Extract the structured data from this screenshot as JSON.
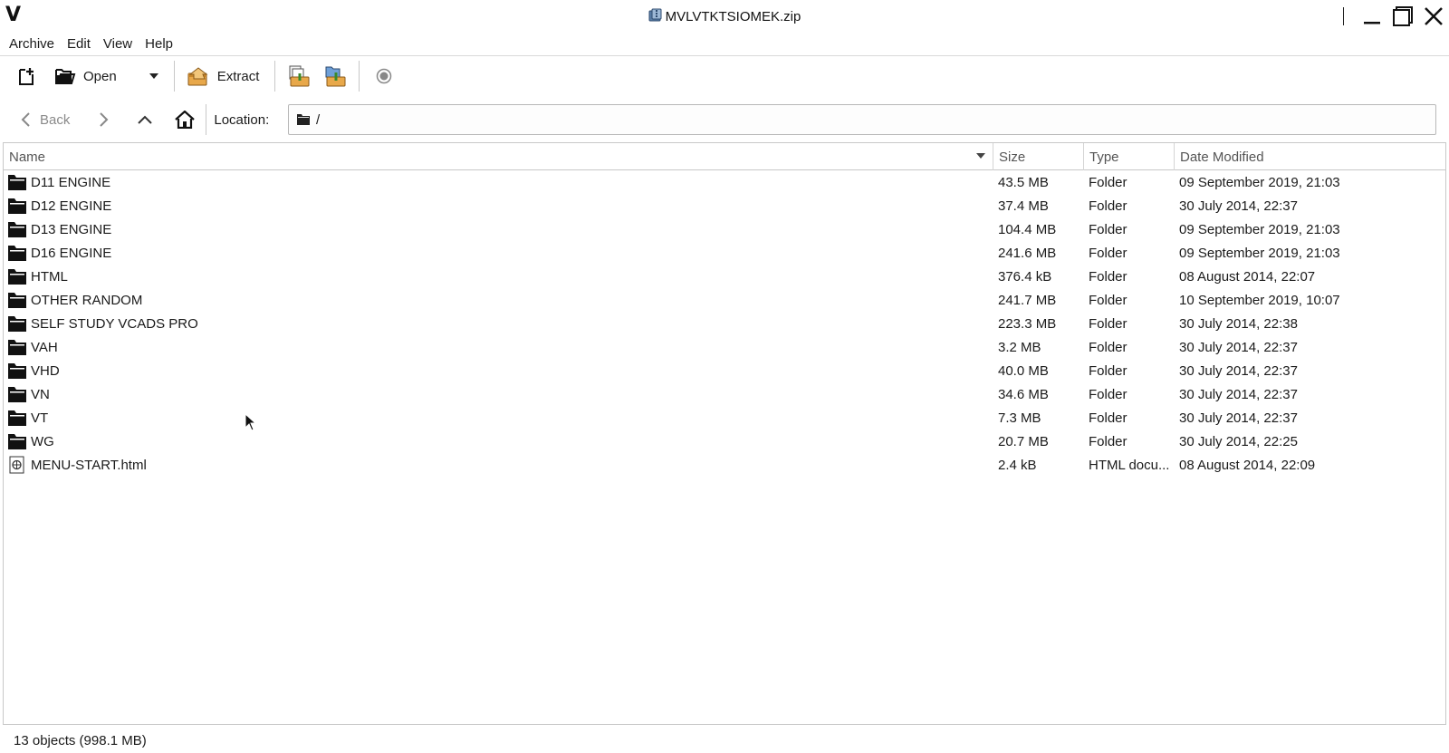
{
  "window": {
    "title": "MVLVTKTSIOMEK.zip",
    "logo": "V",
    "controls": [
      "minimize-icon",
      "maximize-icon",
      "close-icon"
    ]
  },
  "menubar": {
    "items": [
      "Archive",
      "Edit",
      "View",
      "Help"
    ]
  },
  "toolbar": {
    "new_icon": "new-archive-icon",
    "open_label": "Open",
    "extract_label": "Extract",
    "add_files_icon": "add-files-icon",
    "add_folder_icon": "add-folder-icon",
    "stop_icon": "stop-icon"
  },
  "locationbar": {
    "back_label": "Back",
    "location_label": "Location:",
    "path": "/"
  },
  "filelist": {
    "columns": {
      "name": "Name",
      "size": "Size",
      "type": "Type",
      "date": "Date Modified"
    },
    "rows": [
      {
        "name": "D11 ENGINE",
        "size": "43.5 MB",
        "type": "Folder",
        "date": "09 September 2019, 21:03",
        "icon": "folder-icon"
      },
      {
        "name": "D12 ENGINE",
        "size": "37.4 MB",
        "type": "Folder",
        "date": "30 July 2014, 22:37",
        "icon": "folder-icon"
      },
      {
        "name": "D13 ENGINE",
        "size": "104.4 MB",
        "type": "Folder",
        "date": "09 September 2019, 21:03",
        "icon": "folder-icon"
      },
      {
        "name": "D16 ENGINE",
        "size": "241.6 MB",
        "type": "Folder",
        "date": "09 September 2019, 21:03",
        "icon": "folder-icon"
      },
      {
        "name": "HTML",
        "size": "376.4 kB",
        "type": "Folder",
        "date": "08 August 2014, 22:07",
        "icon": "folder-icon"
      },
      {
        "name": "OTHER RANDOM",
        "size": "241.7 MB",
        "type": "Folder",
        "date": "10 September 2019, 10:07",
        "icon": "folder-icon"
      },
      {
        "name": "SELF STUDY VCADS PRO",
        "size": "223.3 MB",
        "type": "Folder",
        "date": "30 July 2014, 22:38",
        "icon": "folder-icon"
      },
      {
        "name": "VAH",
        "size": "3.2 MB",
        "type": "Folder",
        "date": "30 July 2014, 22:37",
        "icon": "folder-icon"
      },
      {
        "name": "VHD",
        "size": "40.0 MB",
        "type": "Folder",
        "date": "30 July 2014, 22:37",
        "icon": "folder-icon"
      },
      {
        "name": "VN",
        "size": "34.6 MB",
        "type": "Folder",
        "date": "30 July 2014, 22:37",
        "icon": "folder-icon"
      },
      {
        "name": "VT",
        "size": "7.3 MB",
        "type": "Folder",
        "date": "30 July 2014, 22:37",
        "icon": "folder-icon"
      },
      {
        "name": "WG",
        "size": "20.7 MB",
        "type": "Folder",
        "date": "30 July 2014, 22:25",
        "icon": "folder-icon"
      },
      {
        "name": "MENU-START.html",
        "size": "2.4 kB",
        "type": "HTML docu...",
        "date": "08 August 2014, 22:09",
        "icon": "html-file-icon"
      }
    ]
  },
  "statusbar": {
    "text": "13 objects (998.1 MB)"
  },
  "colors": {
    "accent": "#d08a2a",
    "text": "#1a1a1a",
    "muted": "#8a8a8a"
  }
}
